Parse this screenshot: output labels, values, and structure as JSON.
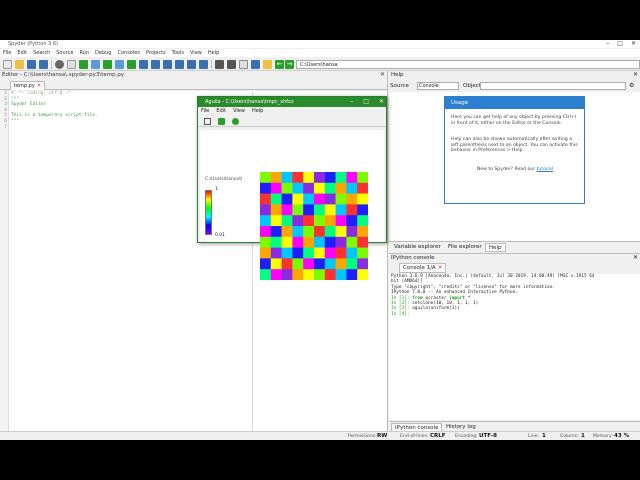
{
  "window": {
    "title": "Spyder (Python 3.6)"
  },
  "menu": [
    "File",
    "Edit",
    "Search",
    "Source",
    "Run",
    "Debug",
    "Consoles",
    "Projects",
    "Tools",
    "View",
    "Help"
  ],
  "toolbar": {
    "path": "C:\\Users\\hansa"
  },
  "editor": {
    "pane_title": "Editor - C:\\Users\\hansa\\.spyder-py3\\temp.py",
    "tab": "temp.py",
    "line_numbers": [
      "1",
      "2",
      "3",
      "4",
      "5",
      "6",
      "7"
    ],
    "lines": [
      "# -*- coding: utf-8 -*-",
      "\"\"\"",
      "Spyder Editor",
      "",
      "This is a temporary script file.",
      "\"\"\"",
      ""
    ]
  },
  "help": {
    "pane_title": "Help",
    "source_label": "Source",
    "source_value": "Console",
    "object_label": "Object",
    "usage_title": "Usage",
    "p1": "Here you can get help of any object by pressing Ctrl+I in front of it, either on the Editor or the Console.",
    "p2": "Help can also be shown automatically after writing a left parenthesis next to an object. You can activate this behavior in Preferences > Help.",
    "p3_prefix": "New to Spyder? Read our",
    "p3_link": "tutorial",
    "tabs": [
      "Variable explorer",
      "File explorer",
      "Help"
    ]
  },
  "console": {
    "pane_title": "IPython console",
    "tab": "Console 1/A",
    "lines": [
      "Python 3.6.9 |Anaconda, Inc.| (default, Jul 30 2019, 14:00:49) [MSC v.1915 64",
      "bit (AMD64)]",
      "Type \"copyright\", \"credits\" or \"license\" for more information.",
      "",
      "IPython 7.0.0 -- An enhanced Interactive Python.",
      ""
    ],
    "in1_prompt": "In [1]:",
    "in1_kw1": "from",
    "in1_mid": " pcraster ",
    "in1_kw2": "import",
    "in1_end": " *",
    "in2_prompt": "In [2]:",
    "in2_code": " setclone(10, 10, 1, 1, 1)",
    "in3_prompt": "In [3]:",
    "in3_code": " aguila(uniform(1))",
    "in4_prompt": "In [4]:",
    "tabs": [
      "IPython console",
      "History log"
    ]
  },
  "status": {
    "permissions_label": "Permissions:",
    "permissions": "RW",
    "eol_label": "End-of-lines:",
    "eol": "CRLF",
    "encoding_label": "Encoding:",
    "encoding": "UTF-8",
    "line_label": "Line:",
    "line": "1",
    "column_label": "Column:",
    "column": "1",
    "memory_label": "Memory:",
    "memory": "43 %"
  },
  "aguila": {
    "title": "Aguila - C:\\Users\\hansa\\tmpc_xhfxz",
    "menu": [
      "File",
      "Edit",
      "View",
      "Help"
    ],
    "path": "C:\\Users\\hansa\\t",
    "legend_max": "1",
    "legend_min": "0.01",
    "grid_colors": [
      "#7cfc00",
      "#ffa500",
      "#00c8ff",
      "#ff3030",
      "#ffff00",
      "#8a2be2",
      "#1e1eff",
      "#00ff7f",
      "#ff00ff",
      "#7cfc00",
      "#1e1eff",
      "#ff00ff",
      "#7cfc00",
      "#00c8ff",
      "#8a2be2",
      "#ffff00",
      "#00ff7f",
      "#ffa500",
      "#00c8ff",
      "#ff3030",
      "#ff3030",
      "#00ff7f",
      "#1e1eff",
      "#ffff00",
      "#00c8ff",
      "#ff00ff",
      "#8a2be2",
      "#7cfc00",
      "#ffa500",
      "#ffff00",
      "#8a2be2",
      "#ffa500",
      "#ff00ff",
      "#7cfc00",
      "#1e1eff",
      "#00ff7f",
      "#ffff00",
      "#00c8ff",
      "#ff3030",
      "#1e1eff",
      "#00c8ff",
      "#ffff00",
      "#00ff7f",
      "#8a2be2",
      "#ff3030",
      "#7cfc00",
      "#ffa500",
      "#ff00ff",
      "#1e1eff",
      "#00ff7f",
      "#ff00ff",
      "#1e1eff",
      "#ffa500",
      "#00c8ff",
      "#7cfc00",
      "#ff3030",
      "#00ff7f",
      "#ffff00",
      "#8a2be2",
      "#ffa500",
      "#7cfc00",
      "#00ff7f",
      "#ffff00",
      "#ff00ff",
      "#ffa500",
      "#00c8ff",
      "#1e1eff",
      "#8a2be2",
      "#7cfc00",
      "#ff3030",
      "#ffa500",
      "#8a2be2",
      "#00c8ff",
      "#1e1eff",
      "#00ff7f",
      "#ffff00",
      "#ff00ff",
      "#ff3030",
      "#00c8ff",
      "#7cfc00",
      "#1e1eff",
      "#ffff00",
      "#ff3030",
      "#7cfc00",
      "#ff00ff",
      "#1e1eff",
      "#00c8ff",
      "#ffa500",
      "#00ff7f",
      "#8a2be2",
      "#00ff7f",
      "#ff00ff",
      "#8a2be2",
      "#ffa500",
      "#ffff00",
      "#7cfc00",
      "#ff3030",
      "#00c8ff",
      "#1e1eff",
      "#ffff00"
    ]
  }
}
